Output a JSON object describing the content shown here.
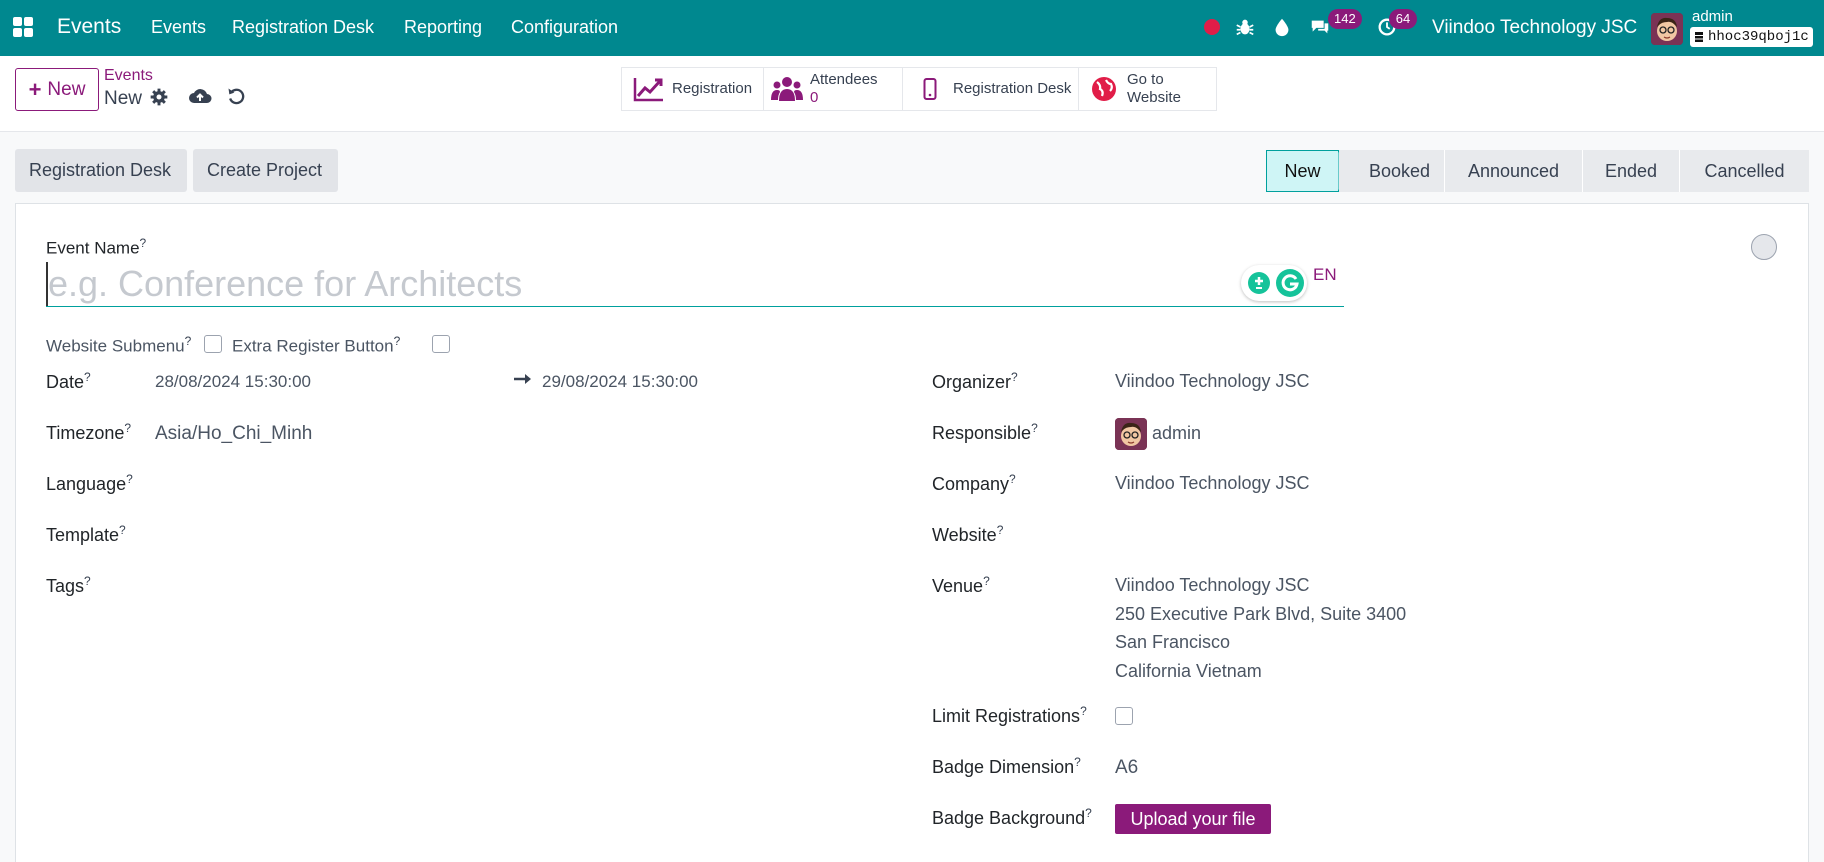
{
  "navbar": {
    "app_title": "Events",
    "menu": [
      "Events",
      "Registration Desk",
      "Reporting",
      "Configuration"
    ],
    "messages_count": "142",
    "activities_count": "64",
    "company": "Viindoo Technology JSC",
    "user": "admin",
    "database": "hhoc39qboj1c"
  },
  "control_panel": {
    "new_label": "New",
    "breadcrumb_parent": "Events",
    "breadcrumb_current": "New",
    "smart_buttons": {
      "registration": "Registration",
      "attendees": "Attendees",
      "attendees_count": "0",
      "registration_desk": "Registration Desk",
      "go_to_website_line1": "Go to",
      "go_to_website_line2": "Website"
    }
  },
  "header_actions": {
    "registration_desk": "Registration Desk",
    "create_project": "Create Project"
  },
  "statusbar": {
    "stages": [
      "New",
      "Booked",
      "Announced",
      "Ended",
      "Cancelled"
    ],
    "active": "New"
  },
  "form": {
    "event_name_label": "Event Name",
    "event_name_placeholder": "e.g. Conference for Architects",
    "lang": "EN",
    "website_submenu_label": "Website Submenu",
    "extra_register_label": "Extra Register Button",
    "date_label": "Date",
    "date_begin": "28/08/2024 15:30:00",
    "date_end": "29/08/2024 15:30:00",
    "timezone_label": "Timezone",
    "timezone": "Asia/Ho_Chi_Minh",
    "language_label": "Language",
    "template_label": "Template",
    "tags_label": "Tags",
    "organizer_label": "Organizer",
    "organizer": "Viindoo Technology JSC",
    "responsible_label": "Responsible",
    "responsible": "admin",
    "company_label": "Company",
    "company": "Viindoo Technology JSC",
    "website_label": "Website",
    "venue_label": "Venue",
    "venue_lines": [
      "Viindoo Technology JSC",
      "250 Executive Park Blvd, Suite 3400",
      "San Francisco",
      "California Vietnam"
    ],
    "limit_registrations_label": "Limit Registrations",
    "badge_dimension_label": "Badge Dimension",
    "badge_dimension": "A6",
    "badge_background_label": "Badge Background",
    "upload_label": "Upload your file",
    "help_mark": "?"
  }
}
